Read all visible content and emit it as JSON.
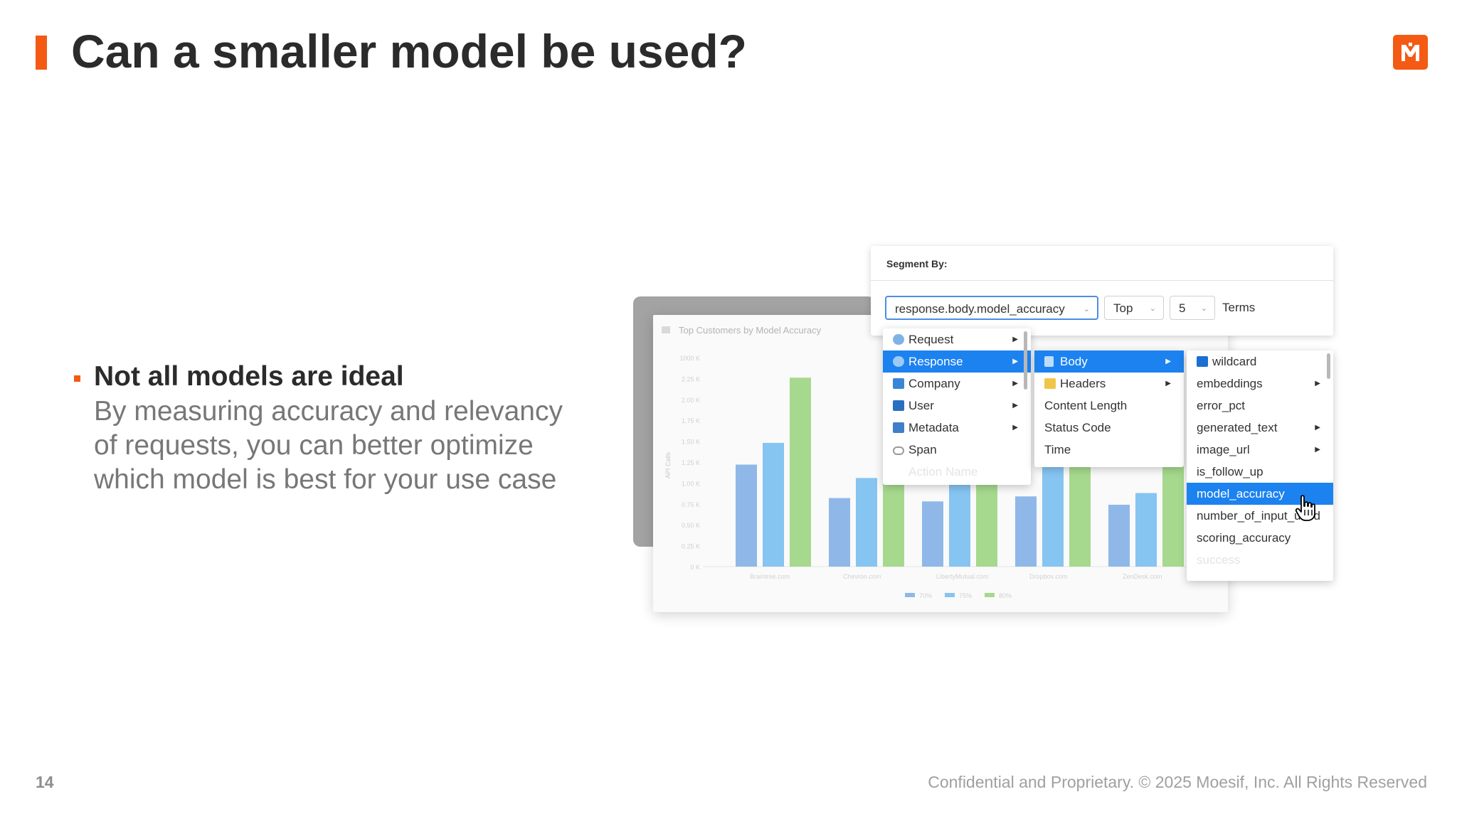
{
  "slide": {
    "title": "Can a smaller model be used?",
    "bullet_heading": "Not all models are ideal",
    "bullet_body": "By measuring accuracy and relevancy of requests, you can better optimize which model is best for your use case",
    "page_number": "14",
    "footer": "Confidential and Proprietary. © 2025 Moesif, Inc. All Rights Reserved",
    "accent_color": "#f45a14"
  },
  "chart": {
    "title": "Top Customers by Model Accuracy",
    "ylabel": "API Calls"
  },
  "chart_data": {
    "type": "bar",
    "title": "Top Customers by Model Accuracy",
    "ylabel": "API Calls",
    "y_ticks": [
      "0 K",
      "0.25 K",
      "0.50 K",
      "0.75 K",
      "1.00 K",
      "1.25 K",
      "1.50 K",
      "1.75 K",
      "2.00 K",
      "2.25 K",
      "1000 K"
    ],
    "ylim": [
      0,
      2500
    ],
    "categories": [
      "Braintree.com",
      "Chevron.com",
      "LibertyMutual.com",
      "Dropbox.com",
      "ZenDesk.com"
    ],
    "series": [
      {
        "name": "70%",
        "color": "#8fb8e8",
        "values": [
          1220,
          820,
          780,
          840,
          740
        ]
      },
      {
        "name": "75%",
        "color": "#86c4f2",
        "values": [
          1480,
          1060,
          1220,
          1300,
          880
        ]
      },
      {
        "name": "80%",
        "color": "#a6d98e",
        "values": [
          2260,
          1000,
          1460,
          1380,
          1220
        ]
      }
    ],
    "legend": "bottom"
  },
  "segment": {
    "label": "Segment By:",
    "field_value": "response.body.model_accuracy",
    "order_value": "Top",
    "count_value": "5",
    "terms_label": "Terms"
  },
  "menu1": {
    "items": [
      {
        "label": "Request",
        "icon": "globe-icon"
      },
      {
        "label": "Response",
        "icon": "globe-icon"
      },
      {
        "label": "Company",
        "icon": "building-icon"
      },
      {
        "label": "User",
        "icon": "user-icon"
      },
      {
        "label": "Metadata",
        "icon": "save-icon"
      },
      {
        "label": "Span",
        "icon": "link-icon"
      },
      {
        "label": "Action Name",
        "icon": ""
      }
    ]
  },
  "menu2": {
    "items": [
      {
        "label": "Body",
        "icon": "document-icon"
      },
      {
        "label": "Headers",
        "icon": "folder-icon"
      },
      {
        "label": "Content Length"
      },
      {
        "label": "Status Code"
      },
      {
        "label": "Time"
      }
    ]
  },
  "menu3": {
    "items": [
      {
        "label": "wildcard",
        "icon": "star-box-icon"
      },
      {
        "label": "embeddings"
      },
      {
        "label": "error_pct"
      },
      {
        "label": "generated_text"
      },
      {
        "label": "image_url"
      },
      {
        "label": "is_follow_up"
      },
      {
        "label": "model_accuracy"
      },
      {
        "label": "number_of_input_used"
      },
      {
        "label": "scoring_accuracy"
      },
      {
        "label": "success"
      }
    ]
  }
}
